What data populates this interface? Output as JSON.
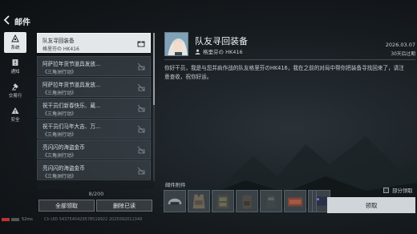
{
  "header": {
    "title": "邮件"
  },
  "sidebar": {
    "items": [
      {
        "label": "系统",
        "icon": "system-icon",
        "active": true
      },
      {
        "label": "通知",
        "icon": "notice-icon",
        "active": false
      },
      {
        "label": "交易行",
        "icon": "trade-icon",
        "active": false
      },
      {
        "label": "安全",
        "icon": "security-icon",
        "active": false
      }
    ]
  },
  "mail_list": {
    "items": [
      {
        "title": "队友寻回装备",
        "sub": "格里芬の HK416"
      },
      {
        "title": "阿萨拉年货节道具发放...",
        "sub": "《三角洲行动》"
      },
      {
        "title": "阿萨拉年货节道具发放...",
        "sub": "《三角洲行动》"
      },
      {
        "title": "祝干员们新春快乐、蔵...",
        "sub": "《三角洲行动》"
      },
      {
        "title": "祝干员们马年大吉、万...",
        "sub": "《三角洲行动》"
      },
      {
        "title": "亮闪闪的海盗金币",
        "sub": "《三角洲行动》"
      },
      {
        "title": "亮闪闪的海盗金币",
        "sub": "《三角洲行动》"
      }
    ],
    "count": "8/200",
    "claim_all": "全部领取",
    "delete_read": "删除已读"
  },
  "detail": {
    "title": "队友寻回装备",
    "sender": "格里芬の HK416",
    "date": "2026.03.07",
    "expire": "30天后过期",
    "body": "你好干员，我是与您并肩作战的队友格里芬のHK416，我在之前的对局中帮你把装备寻找回来了，请注意查收，祝你好运。",
    "attachments_label": "邮件附件",
    "partial_claim": "部分领取",
    "claim": "领取"
  },
  "footer": {
    "ping": "52ms",
    "uid": "Ch UID 5437540429578519922 2025092011349"
  },
  "colors": {
    "accent": "#e6e9ec",
    "claim_button": "#cfd5d9",
    "ping_red": "#c23030"
  }
}
